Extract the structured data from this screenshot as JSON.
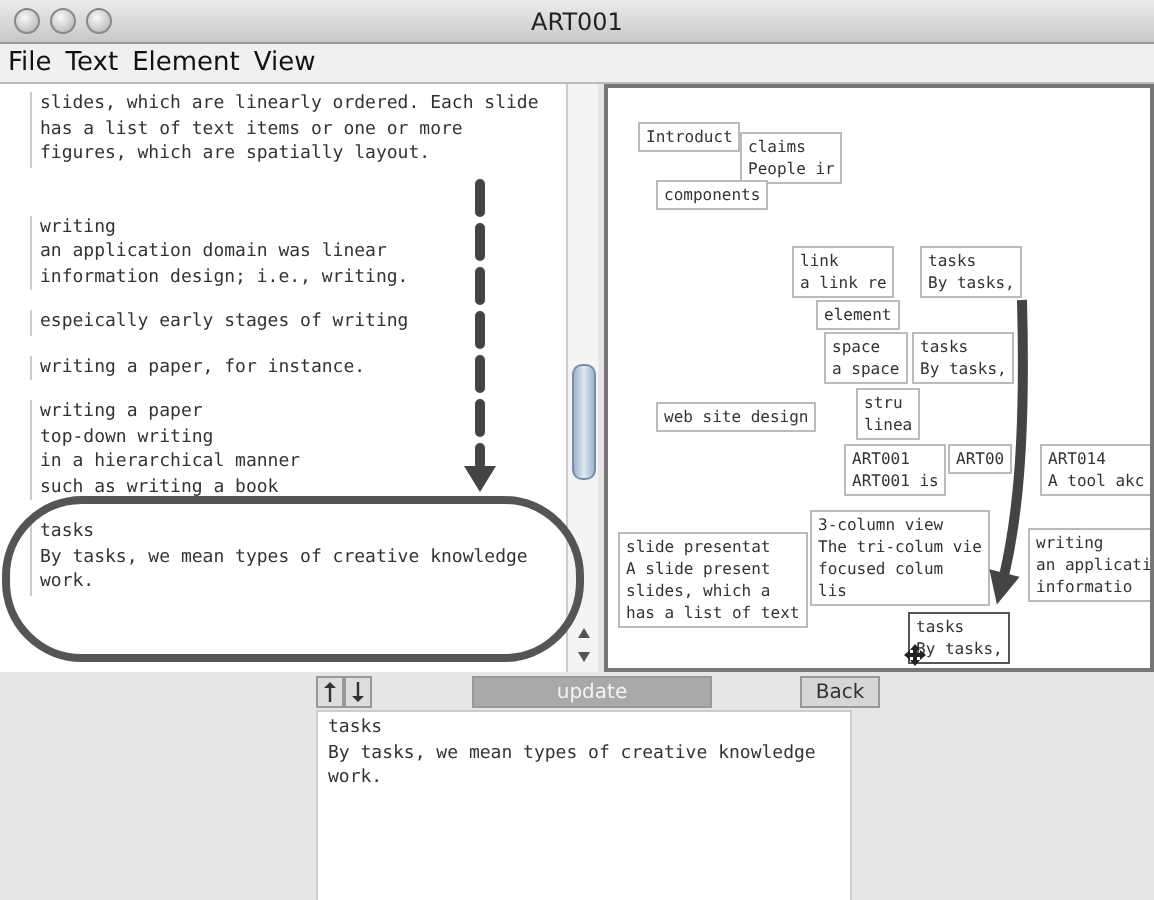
{
  "window": {
    "title": "ART001"
  },
  "menu": [
    "File",
    "Text",
    "Element",
    "View"
  ],
  "text_pane": {
    "paragraphs": [
      {
        "lines": [
          "slides, which are linearly ordered. Each slide",
          "has a list of text items or one or more",
          "figures, which are spatially layout."
        ]
      },
      {
        "lines": [
          "writing",
          "an application domain was linear",
          "information design; i.e., writing."
        ]
      },
      {
        "lines": [
          "espeically early stages of writing"
        ]
      },
      {
        "lines": [
          "writing a paper, for instance."
        ]
      },
      {
        "lines": [
          "writing a paper",
          "top-down writing",
          "in a hierarchical manner",
          "such as writing a book"
        ]
      },
      {
        "lines": [
          "tasks",
          "By tasks, we mean types of creative knowledge",
          "work."
        ]
      }
    ]
  },
  "canvas": {
    "nodes": [
      {
        "lines": [
          "Introduct"
        ],
        "selected": false
      },
      {
        "lines": [
          "claims",
          "People ir"
        ],
        "selected": false
      },
      {
        "lines": [
          "components"
        ],
        "selected": false
      },
      {
        "lines": [
          "link",
          "a link re"
        ],
        "selected": false
      },
      {
        "lines": [
          "element"
        ],
        "selected": false
      },
      {
        "lines": [
          "space",
          "a space"
        ],
        "selected": false
      },
      {
        "lines": [
          "stru",
          "linea"
        ],
        "selected": false
      },
      {
        "lines": [
          "tasks",
          "By tasks,"
        ],
        "selected": false
      },
      {
        "lines": [
          "tasks",
          "By tasks,"
        ],
        "selected": false
      },
      {
        "lines": [
          "web site design"
        ],
        "selected": false
      },
      {
        "lines": [
          "ART001",
          "ART001 is"
        ],
        "selected": false
      },
      {
        "lines": [
          "ART00"
        ],
        "selected": false
      },
      {
        "lines": [
          "ART014",
          "A tool akc"
        ],
        "selected": false
      },
      {
        "lines": [
          "slide presentat",
          "A slide present",
          "slides, which a",
          "has a list of text"
        ],
        "selected": false
      },
      {
        "lines": [
          "3-column view",
          "The tri-colum vie",
          "focused colum",
          "lis"
        ],
        "selected": false
      },
      {
        "lines": [
          "writing",
          "an applicati",
          "informatio"
        ],
        "selected": false
      },
      {
        "lines": [
          "tasks",
          "By tasks,"
        ],
        "selected": true
      }
    ]
  },
  "detail": {
    "update_button": {
      "label": "update",
      "disabled": true
    },
    "back_button": {
      "label": "Back"
    },
    "lines": [
      "tasks",
      "By tasks, we mean types of creative knowledge",
      "work."
    ]
  }
}
